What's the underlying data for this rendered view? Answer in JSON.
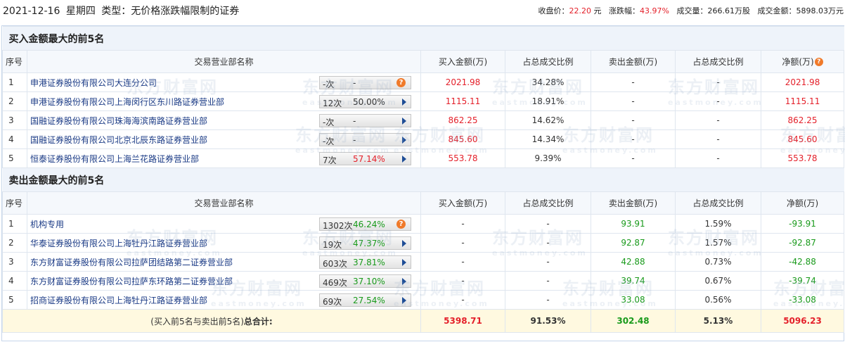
{
  "header": {
    "date": "2021-12-16",
    "weekday": "星期四",
    "type_label": "类型：",
    "type_value": "无价格涨跌幅限制的证券",
    "close_label": "收盘价：",
    "close_value": "22.20",
    "close_unit": "元",
    "change_label": "涨跌幅：",
    "change_value": "43.97%",
    "volume_label": "成交量：",
    "volume_value": "266.61万股",
    "amount_label": "成交金额：",
    "amount_value": "5898.03万元"
  },
  "columns": {
    "idx": "序号",
    "name": "交易营业部名称",
    "buy": "买入金额(万)",
    "buy_pct": "占总成交比例",
    "sell": "卖出金额(万)",
    "sell_pct": "占总成交比例",
    "net": "净额(万)"
  },
  "buy_section": {
    "title": "买入金额最大的前5名",
    "rows": [
      {
        "idx": "1",
        "name": "申港证券股份有限公司大连分公司",
        "count": "-次",
        "rate": "-",
        "rate_color": "neutral",
        "pill_icon": "question-icon",
        "buy": "2021.98",
        "buy_pct": "34.28%",
        "sell": "-",
        "sell_pct": "-",
        "net": "2021.98"
      },
      {
        "idx": "2",
        "name": "申港证券股份有限公司上海闵行区东川路证券营业部",
        "count": "12次",
        "rate": "50.00%",
        "rate_color": "neutral",
        "pill_icon": "arrow-right-icon",
        "buy": "1115.11",
        "buy_pct": "18.91%",
        "sell": "-",
        "sell_pct": "-",
        "net": "1115.11"
      },
      {
        "idx": "3",
        "name": "国融证券股份有限公司珠海海滨南路证券营业部",
        "count": "-次",
        "rate": "-",
        "rate_color": "neutral",
        "pill_icon": "arrow-right-icon",
        "buy": "862.25",
        "buy_pct": "14.62%",
        "sell": "-",
        "sell_pct": "-",
        "net": "862.25"
      },
      {
        "idx": "4",
        "name": "国融证券股份有限公司北京北辰东路证券营业部",
        "count": "-次",
        "rate": "-",
        "rate_color": "neutral",
        "pill_icon": "arrow-right-icon",
        "buy": "845.60",
        "buy_pct": "14.34%",
        "sell": "-",
        "sell_pct": "-",
        "net": "845.60"
      },
      {
        "idx": "5",
        "name": "恒泰证券股份有限公司上海兰花路证券营业部",
        "count": "7次",
        "rate": "57.14%",
        "rate_color": "red",
        "pill_icon": "arrow-right-icon",
        "buy": "553.78",
        "buy_pct": "9.39%",
        "sell": "-",
        "sell_pct": "-",
        "net": "553.78"
      }
    ]
  },
  "sell_section": {
    "title": "卖出金额最大的前5名",
    "rows": [
      {
        "idx": "1",
        "name": "机构专用",
        "count": "1302次",
        "rate": "46.24%",
        "rate_color": "green",
        "pill_icon": "question-icon",
        "buy": "-",
        "buy_pct": "-",
        "sell": "93.91",
        "sell_pct": "1.59%",
        "net": "-93.91"
      },
      {
        "idx": "2",
        "name": "华泰证券股份有限公司上海牡丹江路证券营业部",
        "count": "19次",
        "rate": "47.37%",
        "rate_color": "green",
        "pill_icon": "arrow-right-icon",
        "buy": "-",
        "buy_pct": "-",
        "sell": "92.87",
        "sell_pct": "1.57%",
        "net": "-92.87"
      },
      {
        "idx": "3",
        "name": "东方财富证券股份有限公司拉萨团结路第二证券营业部",
        "count": "603次",
        "rate": "37.81%",
        "rate_color": "green",
        "pill_icon": "arrow-right-icon",
        "buy": "-",
        "buy_pct": "-",
        "sell": "42.88",
        "sell_pct": "0.73%",
        "net": "-42.88"
      },
      {
        "idx": "4",
        "name": "东方财富证券股份有限公司拉萨东环路第二证券营业部",
        "count": "469次",
        "rate": "37.10%",
        "rate_color": "green",
        "pill_icon": "arrow-right-icon",
        "buy": "-",
        "buy_pct": "-",
        "sell": "39.74",
        "sell_pct": "0.67%",
        "net": "-39.74"
      },
      {
        "idx": "5",
        "name": "招商证券股份有限公司上海牡丹江路证券营业部",
        "count": "69次",
        "rate": "27.54%",
        "rate_color": "green",
        "pill_icon": "arrow-right-icon",
        "buy": "-",
        "buy_pct": "-",
        "sell": "33.08",
        "sell_pct": "0.56%",
        "net": "-33.08"
      }
    ]
  },
  "total": {
    "label_prefix": "(买入前5名与卖出前5名)",
    "label_strong": "总合计:",
    "buy": "5398.71",
    "buy_pct": "91.53%",
    "sell": "302.48",
    "sell_pct": "5.13%",
    "net": "5096.23"
  },
  "watermark": {
    "zh": "东方财富网",
    "en": "eastmoney.com"
  },
  "colors": {
    "red": "#e4202a",
    "green": "#199a1b",
    "header_bg": "#eef3fa",
    "total_bg": "#fff9e0",
    "icon_orange": "#f07a2a",
    "arrow_blue": "#1e4d96"
  }
}
